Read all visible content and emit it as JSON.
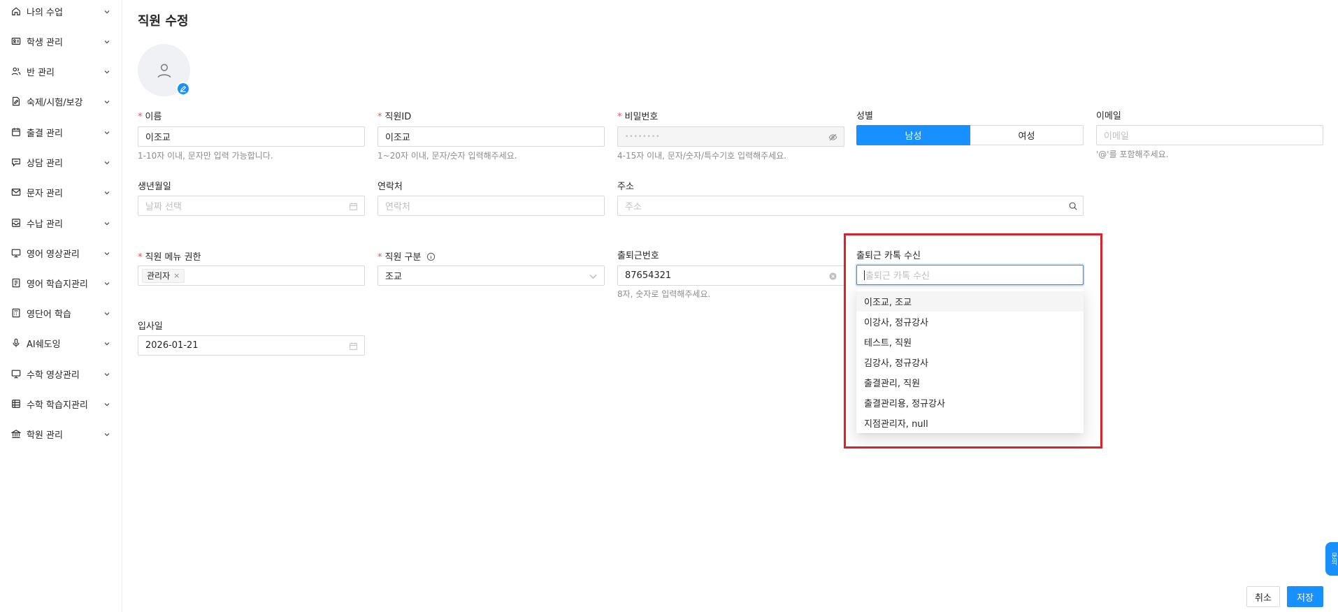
{
  "sidebar": {
    "items": [
      {
        "label": "나의 수업",
        "icon": "home-icon"
      },
      {
        "label": "학생 관리",
        "icon": "id-card-icon"
      },
      {
        "label": "반 관리",
        "icon": "users-icon"
      },
      {
        "label": "숙제/시험/보강",
        "icon": "file-edit-icon"
      },
      {
        "label": "출결 관리",
        "icon": "calendar-icon"
      },
      {
        "label": "상담 관리",
        "icon": "chat-icon"
      },
      {
        "label": "문자 관리",
        "icon": "mail-icon"
      },
      {
        "label": "수납 관리",
        "icon": "inbox-icon"
      },
      {
        "label": "영어 영상관리",
        "icon": "monitor-icon"
      },
      {
        "label": "영어 학습지관리",
        "icon": "book-icon"
      },
      {
        "label": "영단어 학습",
        "icon": "calculator-icon"
      },
      {
        "label": "AI쉐도잉",
        "icon": "microphone-icon"
      },
      {
        "label": "수학 영상관리",
        "icon": "monitor-icon"
      },
      {
        "label": "수학 학습지관리",
        "icon": "table-icon"
      },
      {
        "label": "학원 관리",
        "icon": "bank-icon"
      }
    ]
  },
  "page": {
    "title": "직원 수정"
  },
  "form": {
    "name": {
      "label": "이름",
      "value": "이조교",
      "help": "1-10자 이내, 문자만 입력 가능합니다."
    },
    "staff_id": {
      "label": "직원ID",
      "value": "이조교",
      "help": "1~20자 이내, 문자/숫자 입력해주세요."
    },
    "password": {
      "label": "비밀번호",
      "value": "••••••••",
      "help": "4-15자 이내, 문자/숫자/특수기호 입력해주세요."
    },
    "gender": {
      "label": "성별",
      "options": [
        "남성",
        "여성"
      ],
      "selected": "남성"
    },
    "email": {
      "label": "이메일",
      "placeholder": "이메일",
      "help": "'@'를 포함해주세요."
    },
    "birth": {
      "label": "생년월일",
      "placeholder": "날짜 선택"
    },
    "contact": {
      "label": "연락처",
      "placeholder": "연락처"
    },
    "address": {
      "label": "주소",
      "placeholder": "주소"
    },
    "menu_permission": {
      "label": "직원 메뉴 권한",
      "tags": [
        "관리자"
      ]
    },
    "staff_type": {
      "label": "직원 구분",
      "value": "조교"
    },
    "attendance_number": {
      "label": "출퇴근번호",
      "value": "87654321",
      "help": "8자, 숫자로 입력해주세요."
    },
    "kakao_receive": {
      "label": "출퇴근 카톡 수신",
      "placeholder": "출퇴근 카톡 수신",
      "options": [
        "이조교, 조교",
        "이강사, 정규강사",
        "테스트, 직원",
        "김강사, 정규강사",
        "출결관리, 직원",
        "출결관리용, 정규강사",
        "지점관리자, null"
      ]
    },
    "hire_date": {
      "label": "입사일",
      "value": "2026-01-21"
    }
  },
  "actions": {
    "cancel": "취소",
    "save": "저장"
  },
  "side_tab": {
    "label": "문의"
  },
  "colors": {
    "primary": "#1890ff",
    "required": "#ff4d4f",
    "highlight": "#d9232b"
  }
}
